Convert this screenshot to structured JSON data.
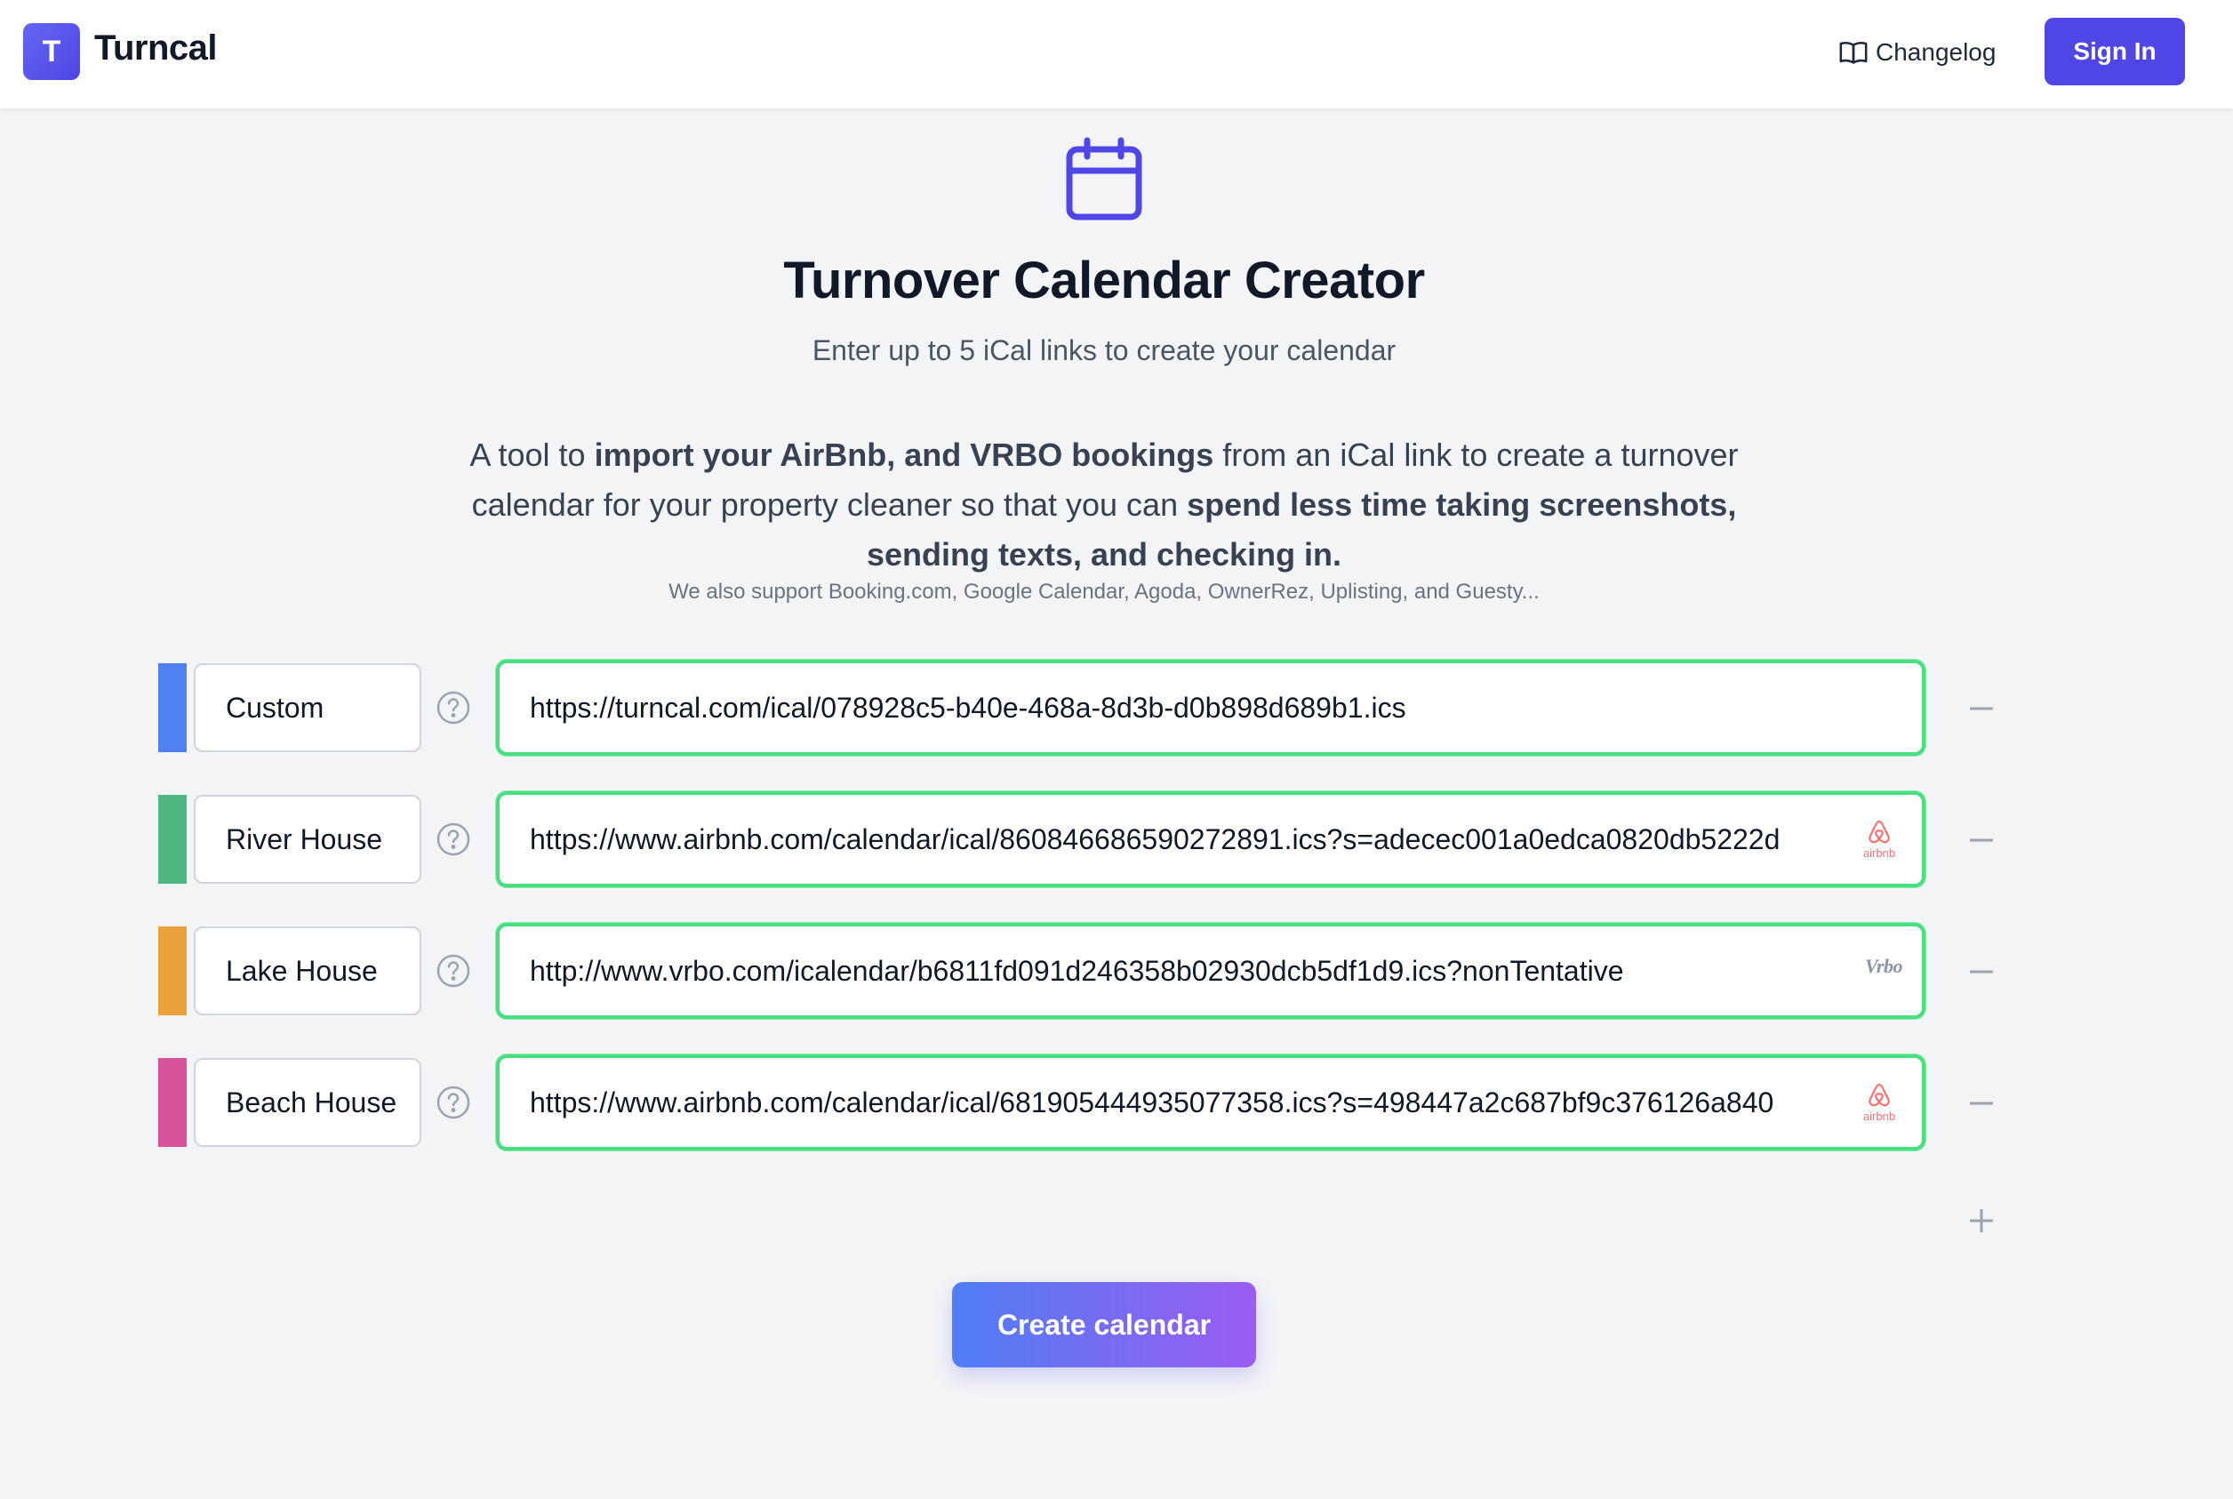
{
  "header": {
    "logo_letter": "T",
    "brand": "Turncal",
    "changelog_label": "Changelog",
    "signin_label": "Sign In"
  },
  "hero": {
    "title": "Turnover Calendar Creator",
    "subtitle": "Enter up to 5 iCal links to create your calendar",
    "desc_1": "A tool to ",
    "desc_2": "import your AirBnb, and VRBO bookings",
    "desc_3": " from an iCal link to create a turnover calendar for your property cleaner so that you can ",
    "desc_4": "spend less time taking screenshots, sending texts, and checking in.",
    "support": "We also support Booking.com, Google Calendar, Agoda, OwnerRez, Uplisting, and Guesty..."
  },
  "rows": [
    {
      "name": "Custom",
      "color": "#4f82f0",
      "url": "https://turncal.com/ical/078928c5-b40e-468a-8d3b-d0b898d689b1.ics",
      "source": "custom"
    },
    {
      "name": "River House",
      "color": "#4fb781",
      "url": "https://www.airbnb.com/calendar/ical/860846686590272891.ics?s=adecec001a0edca0820db5222d",
      "source": "airbnb"
    },
    {
      "name": "Lake House",
      "color": "#e9a23b",
      "url": "http://www.vrbo.com/icalendar/b6811fd091d246358b02930dcb5df1d9.ics?nonTentative",
      "source": "vrbo"
    },
    {
      "name": "Beach House",
      "color": "#d9539a",
      "url": "https://www.airbnb.com/calendar/ical/681905444935077358.ics?s=498447a2c687bf9c376126a840",
      "source": "airbnb"
    }
  ],
  "logos": {
    "airbnb_text": "airbnb",
    "vrbo_text": "Vrbo"
  },
  "create_label": "Create calendar",
  "colors": {
    "accent": "#4f46e5",
    "valid_border": "#4ade80",
    "airbnb": "#f87171"
  }
}
